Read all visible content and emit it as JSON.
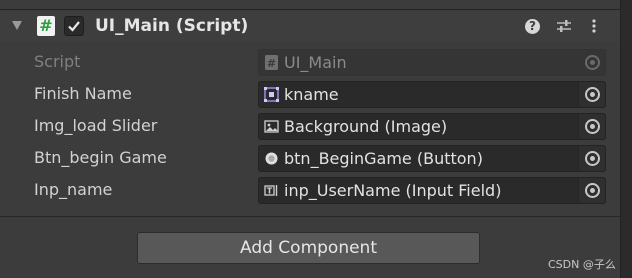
{
  "component": {
    "title": "UI_Main (Script)",
    "enabled": true,
    "icons": [
      "script-icon",
      "help-icon",
      "presets-icon",
      "context-menu-icon"
    ]
  },
  "fields": [
    {
      "label": "Script",
      "value": "UI_Main",
      "icon": "script-file-icon",
      "disabled": true
    },
    {
      "label": "Finish Name",
      "value": "kname",
      "icon": "gameobject-icon",
      "disabled": false
    },
    {
      "label": "Img_load Slider",
      "value": "Background (Image)",
      "icon": "image-icon",
      "disabled": false
    },
    {
      "label": "Btn_begin Game",
      "value": "btn_BeginGame (Button)",
      "icon": "button-icon",
      "disabled": false
    },
    {
      "label": "Inp_name",
      "value": "inp_UserName (Input Field)",
      "icon": "input-field-icon",
      "disabled": false
    }
  ],
  "add_component_label": "Add Component",
  "watermark": "CSDN @子么",
  "colors": {
    "panel": "#3c3c3c",
    "field": "#2a2a2a",
    "button": "#585858",
    "script_icon": "#2a9f3e"
  }
}
